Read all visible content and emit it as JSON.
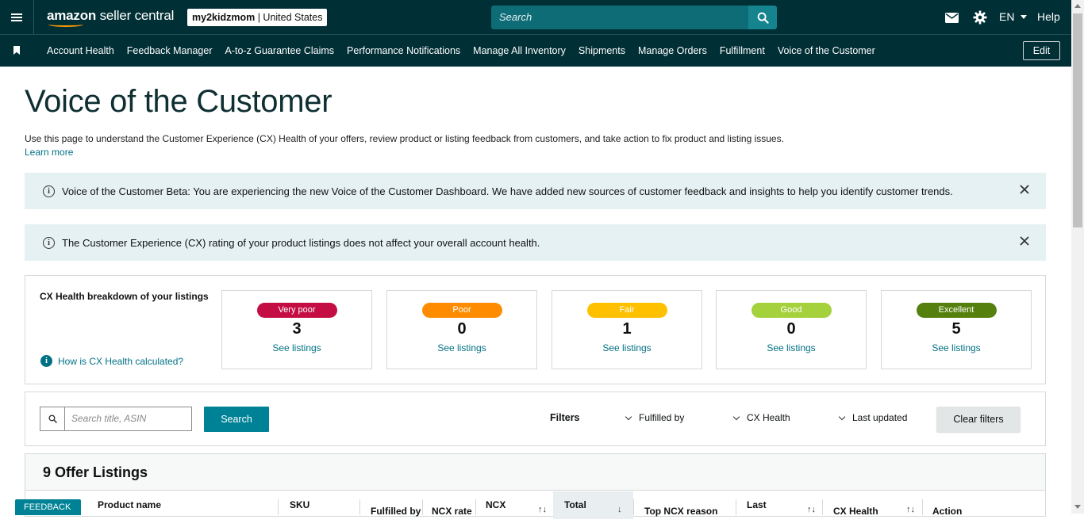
{
  "topbar": {
    "brand_primary": "amazon",
    "brand_secondary": "seller central",
    "store_name": "my2kidzmom",
    "store_region": "United States",
    "search_placeholder": "Search",
    "language": "EN",
    "help_label": "Help"
  },
  "nav": {
    "items": [
      {
        "label": "Account Health"
      },
      {
        "label": "Feedback Manager"
      },
      {
        "label": "A-to-z Guarantee Claims"
      },
      {
        "label": "Performance Notifications"
      },
      {
        "label": "Manage All Inventory"
      },
      {
        "label": "Shipments"
      },
      {
        "label": "Manage Orders"
      },
      {
        "label": "Fulfillment"
      },
      {
        "label": "Voice of the Customer"
      }
    ],
    "edit_label": "Edit"
  },
  "page": {
    "title": "Voice of the Customer",
    "description": "Use this page to understand the Customer Experience (CX) Health of your offers, review product or listing feedback from customers, and take action to fix product and listing issues.",
    "learn_more": "Learn more"
  },
  "banners": [
    {
      "message": "Voice of the Customer Beta: You are experiencing the new Voice of the Customer Dashboard. We have added new sources of customer feedback and insights to help you identify customer trends."
    },
    {
      "message": "The Customer Experience (CX) rating of your product listings does not affect your overall account health."
    }
  ],
  "cx_health": {
    "title": "CX Health breakdown of your listings",
    "how_link": "How is CX Health calculated?",
    "cards": [
      {
        "label": "Very poor",
        "count": "3",
        "link": "See listings",
        "color": "#c40d43"
      },
      {
        "label": "Poor",
        "count": "0",
        "link": "See listings",
        "color": "#ff8c00"
      },
      {
        "label": "Fair",
        "count": "1",
        "link": "See listings",
        "color": "#ffc000"
      },
      {
        "label": "Good",
        "count": "0",
        "link": "See listings",
        "color": "#a4d13c"
      },
      {
        "label": "Excellent",
        "count": "5",
        "link": "See listings",
        "color": "#56800d"
      }
    ]
  },
  "filters": {
    "search_placeholder": "Search title, ASIN",
    "search_button": "Search",
    "filters_label": "Filters",
    "dropdowns": [
      "Fulfilled by",
      "CX Health",
      "Last updated"
    ],
    "clear_label": "Clear filters"
  },
  "listings": {
    "title": "9 Offer Listings",
    "columns": [
      "Product name",
      "SKU",
      "Fulfilled by",
      "NCX rate",
      "NCX",
      "Total",
      "Top NCX reason",
      "Last",
      "CX Health",
      "Action"
    ]
  },
  "feedback_tab": {
    "label": "FEEDBACK"
  }
}
